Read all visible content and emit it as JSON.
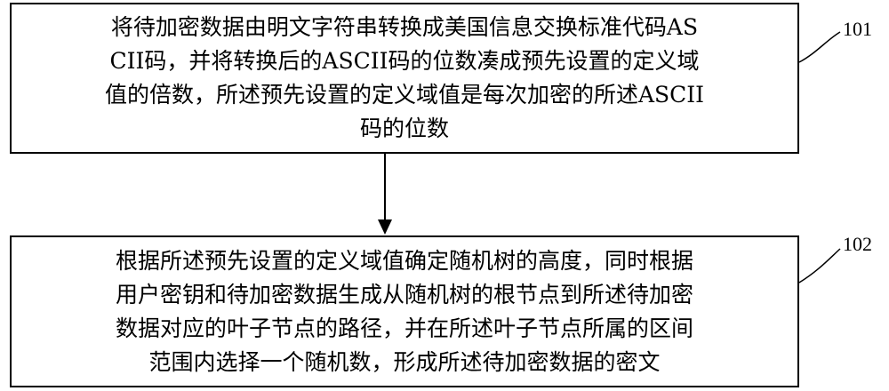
{
  "steps": [
    {
      "id": "101",
      "text": "将待加密数据由明文字符串转换成美国信息交换标准代码AS\nCII码，并将转换后的ASCII码的位数凑成预先设置的定义域\n值的倍数，所述预先设置的定义域值是每次加密的所述ASCII\n码的位数"
    },
    {
      "id": "102",
      "text": "根据所述预先设置的定义域值确定随机树的高度，同时根据\n用户密钥和待加密数据生成从随机树的根节点到所述待加密\n数据对应的叶子节点的路径，并在所述叶子节点所属的区间\n范围内选择一个随机数，形成所述待加密数据的密文"
    }
  ]
}
